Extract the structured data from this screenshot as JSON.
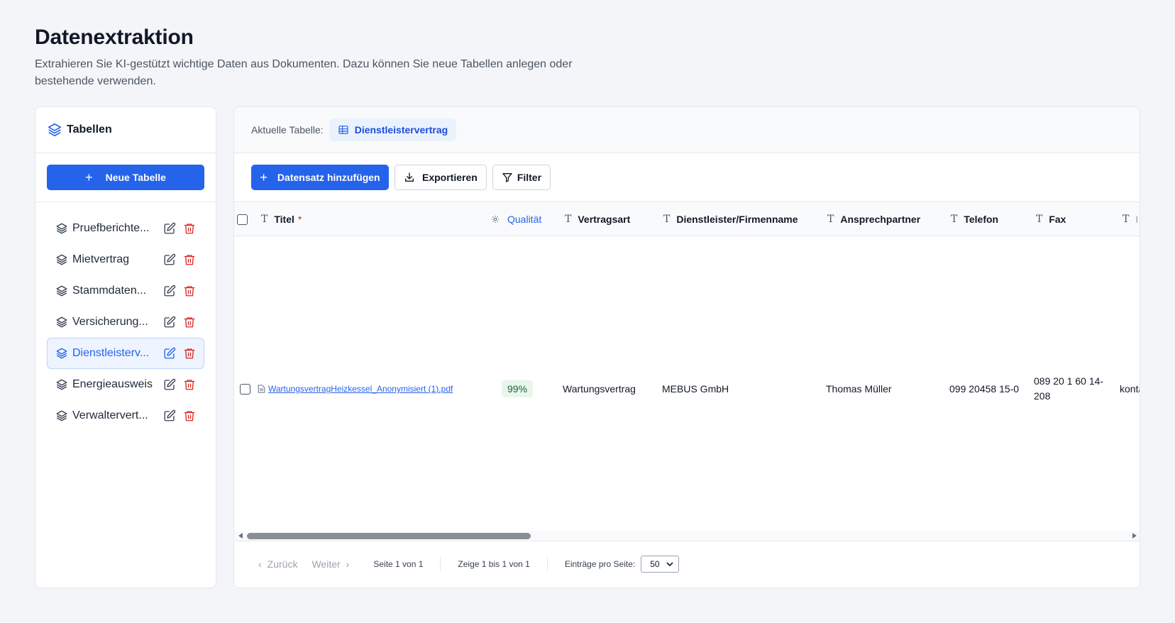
{
  "page": {
    "title": "Datenextraktion",
    "description": "Extrahieren Sie KI-gestützt wichtige Daten aus Dokumenten. Dazu können Sie neue Tabellen anlegen oder bestehende verwenden."
  },
  "sidebar": {
    "header": "Tabellen",
    "new_button": "Neue Tabelle",
    "items": [
      {
        "label": "Pruefberichte...",
        "active": false
      },
      {
        "label": "Mietvertrag",
        "active": false
      },
      {
        "label": "Stammdaten...",
        "active": false
      },
      {
        "label": "Versicherung...",
        "active": false
      },
      {
        "label": "Dienstleisterv...",
        "active": true
      },
      {
        "label": "Energieausweis",
        "active": false
      },
      {
        "label": "Verwaltervert...",
        "active": false
      }
    ]
  },
  "main": {
    "current_table_label": "Aktuelle Tabelle:",
    "current_table_name": "Dienstleistervertrag",
    "toolbar": {
      "add": "Datensatz hinzufügen",
      "export": "Exportieren",
      "filter": "Filter"
    },
    "columns": {
      "titel": "Titel",
      "titel_required": "*",
      "qualitaet": "Qualität",
      "vertragsart": "Vertragsart",
      "dienstleister": "Dienstleister/Firmenname",
      "ansprechpartner": "Ansprechpartner",
      "telefon": "Telefon",
      "fax": "Fax",
      "next": "I"
    },
    "row": {
      "titel": "WartungsvertragHeizkessel_Anonymisiert (1).pdf",
      "qualitaet": "99%",
      "vertragsart": "Wartungsvertrag",
      "dienstleister": "MEBUS GmbH",
      "ansprechpartner": "Thomas Müller",
      "telefon": "099 20458 15-0",
      "fax_line1": "089 20 1 60 14-",
      "fax_line2": "208",
      "next": "konta"
    },
    "pagination": {
      "prev": "Zurück",
      "next": "Weiter",
      "page_info": "Seite 1 von 1",
      "range_info": "Zeige 1 bis 1 von 1",
      "per_page_label": "Einträge pro Seite:",
      "per_page_value": "50"
    }
  },
  "colors": {
    "primary": "#2563eb",
    "danger": "#dc2626",
    "background": "#f3f5f8"
  }
}
